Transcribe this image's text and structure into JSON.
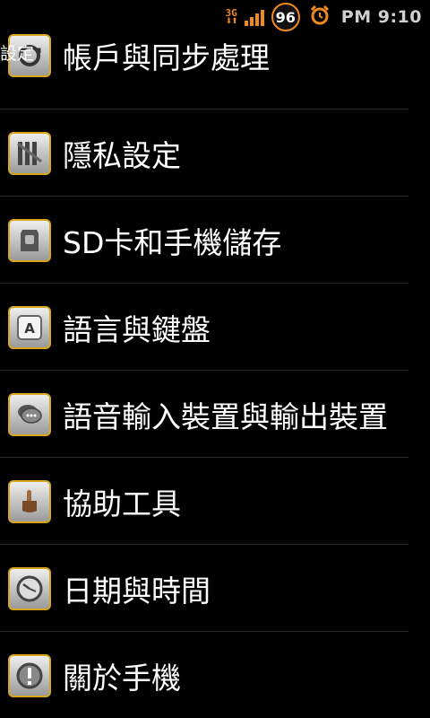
{
  "status_bar": {
    "network": "3G",
    "battery_level": "96",
    "time": "PM 9:10",
    "accent_color": "#f08a1c"
  },
  "header": {
    "title": "設定"
  },
  "settings": {
    "items": [
      {
        "label": "帳戶與同步處理",
        "icon": "sync-icon"
      },
      {
        "label": "隱私設定",
        "icon": "privacy-icon"
      },
      {
        "label": "SD卡和手機儲存",
        "icon": "sd-card-icon"
      },
      {
        "label": "語言與鍵盤",
        "icon": "keyboard-icon"
      },
      {
        "label": "語音輸入裝置與輸出裝置",
        "icon": "speech-bubble-icon"
      },
      {
        "label": "協助工具",
        "icon": "hand-pointer-icon"
      },
      {
        "label": "日期與時間",
        "icon": "clock-icon"
      },
      {
        "label": "關於手機",
        "icon": "info-icon"
      }
    ]
  }
}
